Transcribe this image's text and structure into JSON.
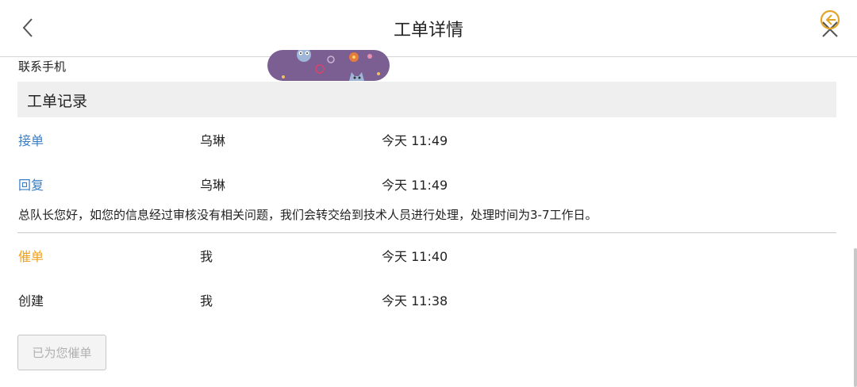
{
  "header": {
    "title": "工单详情",
    "back_icon": "chevron-left-icon",
    "close_icon": "close-icon"
  },
  "contact": {
    "label": "联系手机"
  },
  "section": {
    "title": "工单记录"
  },
  "records": [
    {
      "action": "接单",
      "person": "乌琳",
      "time": "今天 11:49",
      "color": "#3a7fc4"
    },
    {
      "action": "回复",
      "person": "乌琳",
      "time": "今天 11:49",
      "color": "#3a7fc4"
    },
    {
      "action": "催单",
      "person": "我",
      "time": "今天 11:40",
      "color": "#f0a11c"
    },
    {
      "action": "创建",
      "person": "我",
      "time": "今天 11:38",
      "color": "#222222"
    }
  ],
  "reply_text": "总队长您好，如您的信息经过审核没有相关问题，我们会转交给到技术人员进行处理，处理时间为3-7工作日。",
  "urge_button": {
    "label": "已为您催单"
  },
  "colors": {
    "accent_blue": "#3a7fc4",
    "accent_orange": "#f0a11c",
    "sticker_bg": "#7b5e92"
  }
}
